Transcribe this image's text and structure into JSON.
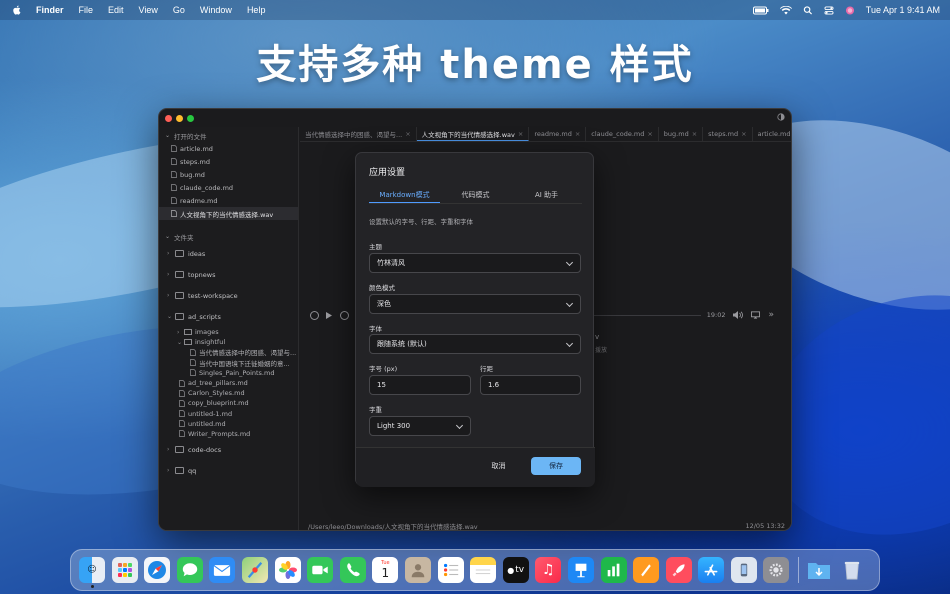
{
  "colors": {
    "accent": "#4f9bff",
    "save_button": "#6cb6f5",
    "window_bg": "#1b1b1d",
    "modal_bg": "#232326",
    "traffic_red": "#ff5f57",
    "traffic_yellow": "#febc2e",
    "traffic_green": "#28c840"
  },
  "menubar": {
    "app": "Finder",
    "items": [
      "File",
      "Edit",
      "View",
      "Go",
      "Window",
      "Help"
    ],
    "clock": "Tue Apr 1  9:41 AM",
    "status_icons": [
      "battery-icon",
      "wifi-icon",
      "search-icon",
      "control-center-icon",
      "siri-icon"
    ]
  },
  "headline": "支持多种 theme 样式",
  "sidebar": {
    "open_files_title": "打开的文件",
    "open_files": [
      "article.md",
      "steps.md",
      "bug.md",
      "claude_code.md",
      "readme.md",
      "人文视角下的当代情感选择.wav"
    ],
    "folders_title": "文件夹",
    "folders_top": [
      "ideas",
      "topnews",
      "test-workspace",
      "ad_scripts"
    ],
    "ad_scripts_children": {
      "images": "images",
      "insightful": "insightful",
      "insightful_files": [
        "当代情感选择中的困惑、渴望与...",
        "当代中国语境下迁徙婚姻的意...",
        "Singles_Pain_Points.md"
      ],
      "files": [
        "ad_tree_pillars.md",
        "Carlon_Styles.md",
        "copy_blueprint.md",
        "untitled-1.md",
        "untitled.md",
        "Writer_Prompts.md"
      ]
    },
    "folders_bottom": [
      "code-docs",
      "qq"
    ]
  },
  "tabs": [
    "当代情感选择中的困惑、渴望与...",
    "人文视角下的当代情感选择.wav",
    "readme.md",
    "claude_code.md",
    "bug.md",
    "steps.md",
    "article.md"
  ],
  "player": {
    "time": "19:02",
    "fragment_1": "v",
    "fragment_2": "援放"
  },
  "status": {
    "path": "/Users/leeo/Downloads/人文视角下的当代情感选择.wav",
    "time": "12/05 13:32"
  },
  "modal": {
    "title": "应用设置",
    "tabs": [
      "Markdown模式",
      "代码模式",
      "AI 助手"
    ],
    "description": "设置默认的字号、行距、字重和字体",
    "theme_label": "主题",
    "theme_value": "竹林清风",
    "color_mode_label": "颜色模式",
    "color_mode_value": "深色",
    "font_label": "字体",
    "font_value": "跟随系统 (默认)",
    "font_size_label": "字号 (px)",
    "font_size_value": "15",
    "line_height_label": "行距",
    "line_height_value": "1.6",
    "weight_label": "字重",
    "weight_value": "Light 300",
    "cancel": "取消",
    "save": "保存"
  },
  "dock": {
    "apps": [
      "finder-icon",
      "launchpad-icon",
      "safari-icon",
      "messages-icon",
      "mail-icon",
      "maps-icon",
      "photos-icon",
      "facetime-icon",
      "phone-icon",
      "calendar-icon",
      "contacts-icon",
      "reminders-icon",
      "notes-icon",
      "tv-icon",
      "music-icon",
      "keynote-icon",
      "numbers-icon",
      "pages-icon",
      "rocket-icon",
      "appstore-icon",
      "iphone-mirroring-icon",
      "settings-icon"
    ],
    "calendar_month": "Tue",
    "calendar_day": "1",
    "tv_label": "tv",
    "extras": [
      "downloads-folder-icon",
      "trash-icon"
    ]
  }
}
